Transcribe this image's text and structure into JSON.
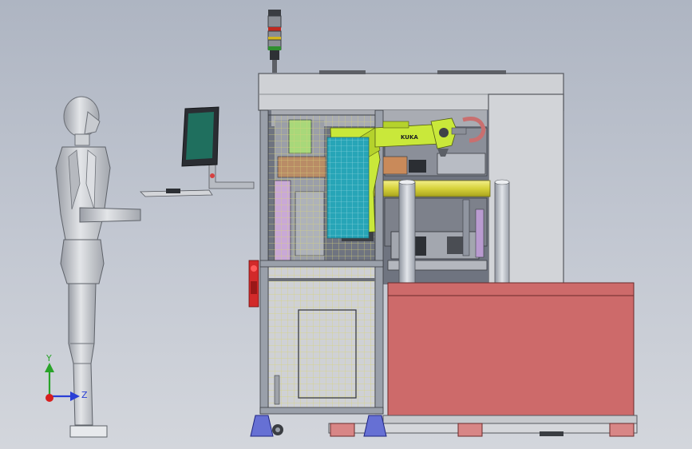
{
  "viewport": {
    "type": "cad-3d-assembly-view",
    "background_colors": [
      "#aeb5c2",
      "#d3d6dc"
    ]
  },
  "robot": {
    "brand_label": "KUKA",
    "color": "#c9e83a"
  },
  "operator_panel": {
    "screen_color": "#1f6f5e"
  },
  "signal_tower": {
    "lights": [
      "red",
      "yellow",
      "green"
    ]
  },
  "conveyor_table": {
    "color": "#cd6a6a"
  },
  "axis_triad": {
    "y_label": "Y",
    "z_label": "Z",
    "y_color": "#29a329",
    "z_color": "#2a3fd6",
    "origin_color": "#d81e1e"
  }
}
